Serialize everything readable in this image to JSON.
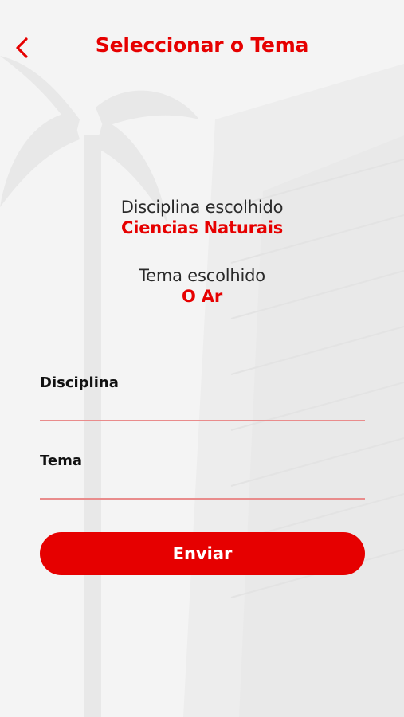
{
  "theme": {
    "accent": "#e60000",
    "background": "#f7f7f7"
  },
  "header": {
    "title": "Seleccionar o Tema",
    "back_icon": "chevron-left-icon"
  },
  "summary": {
    "discipline_label": "Disciplina escolhido",
    "discipline_value": "Ciencias Naturais",
    "topic_label": "Tema escolhido",
    "topic_value": "O Ar"
  },
  "form": {
    "discipline_label": "Disciplina",
    "discipline_value": "",
    "topic_label": "Tema",
    "topic_value": "",
    "submit_label": "Enviar"
  }
}
